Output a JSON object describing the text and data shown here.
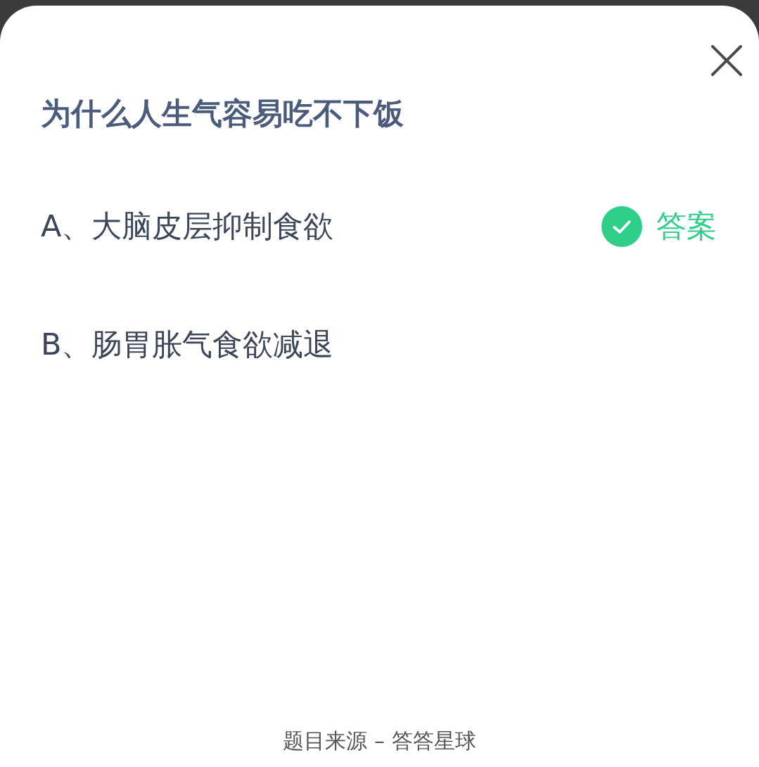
{
  "question": {
    "title": "为什么人生气容易吃不下饭"
  },
  "options": [
    {
      "label": "A、大脑皮层抑制食欲",
      "correct": true,
      "badge": "答案"
    },
    {
      "label": "B、肠胃胀气食欲减退",
      "correct": false
    }
  ],
  "footer": "题目来源 – 答答星球"
}
